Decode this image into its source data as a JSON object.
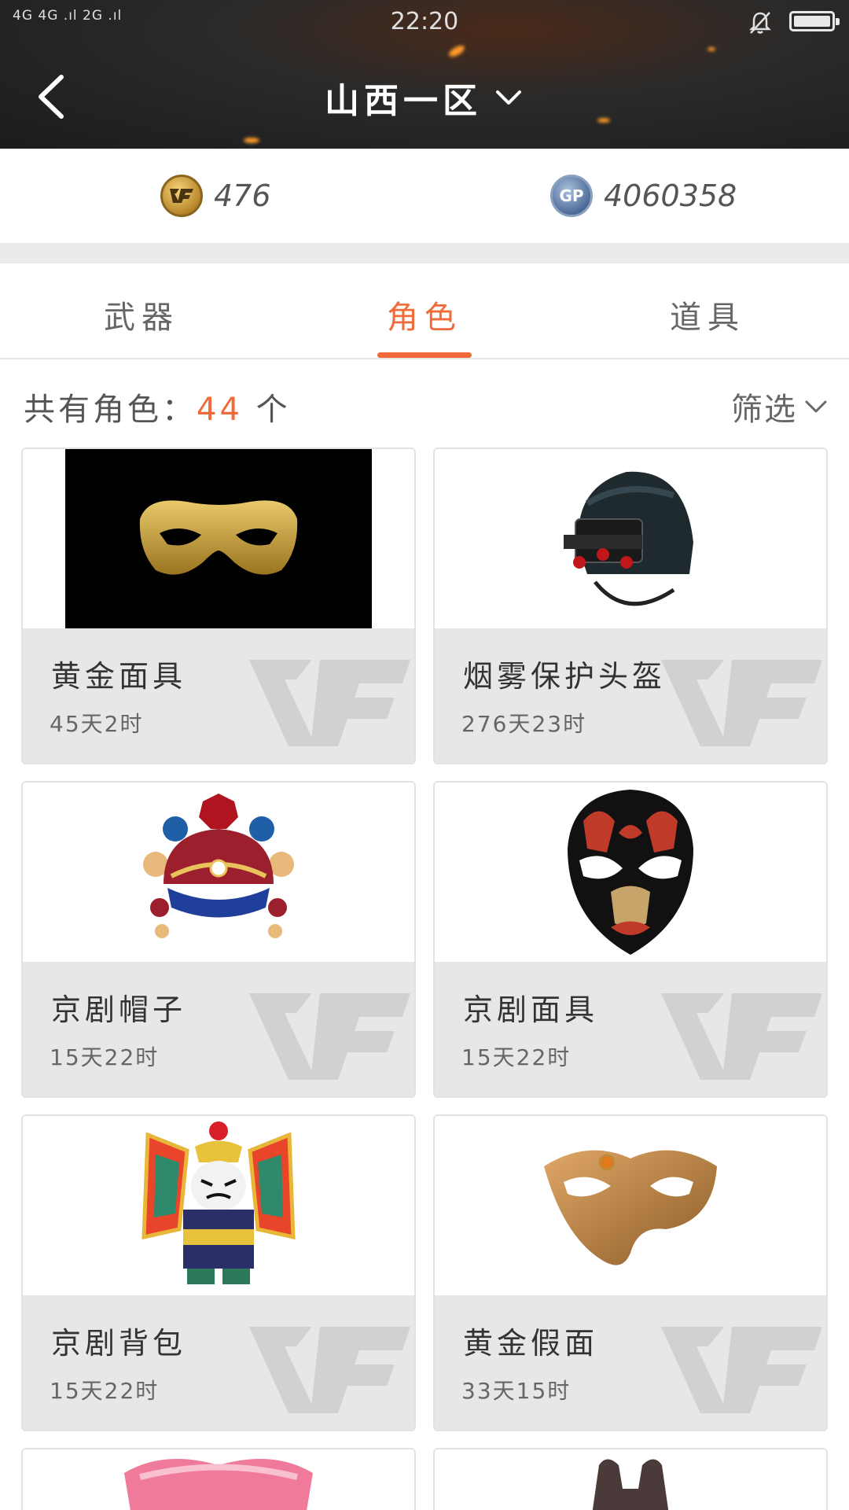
{
  "status_bar": {
    "signal": "4G 4G .ıl 2G .ıl",
    "time": "22:20"
  },
  "header": {
    "title": "山西一区"
  },
  "currency": {
    "cf_points": "476",
    "gp_points": "4060358"
  },
  "tabs": [
    {
      "label": "武器",
      "active": false
    },
    {
      "label": "角色",
      "active": true
    },
    {
      "label": "道具",
      "active": false
    }
  ],
  "summary": {
    "label": "共有角色：",
    "count": "44",
    "unit": "个"
  },
  "filter": {
    "label": "筛选"
  },
  "items": [
    {
      "name": "黄金面具",
      "time": "45天2时",
      "icon": "gold-mask-icon"
    },
    {
      "name": "烟雾保护头盔",
      "time": "276天23时",
      "icon": "smoke-helmet-icon"
    },
    {
      "name": "京剧帽子",
      "time": "15天22时",
      "icon": "opera-hat-icon"
    },
    {
      "name": "京剧面具",
      "time": "15天22时",
      "icon": "opera-mask-icon"
    },
    {
      "name": "京剧背包",
      "time": "15天22时",
      "icon": "opera-backpack-icon"
    },
    {
      "name": "黄金假面",
      "time": "33天15时",
      "icon": "gold-masquerade-icon"
    }
  ],
  "colors": {
    "accent": "#f06a3a",
    "card_info_bg": "#e9e7e5",
    "header_bg": "#1c1c1c"
  }
}
